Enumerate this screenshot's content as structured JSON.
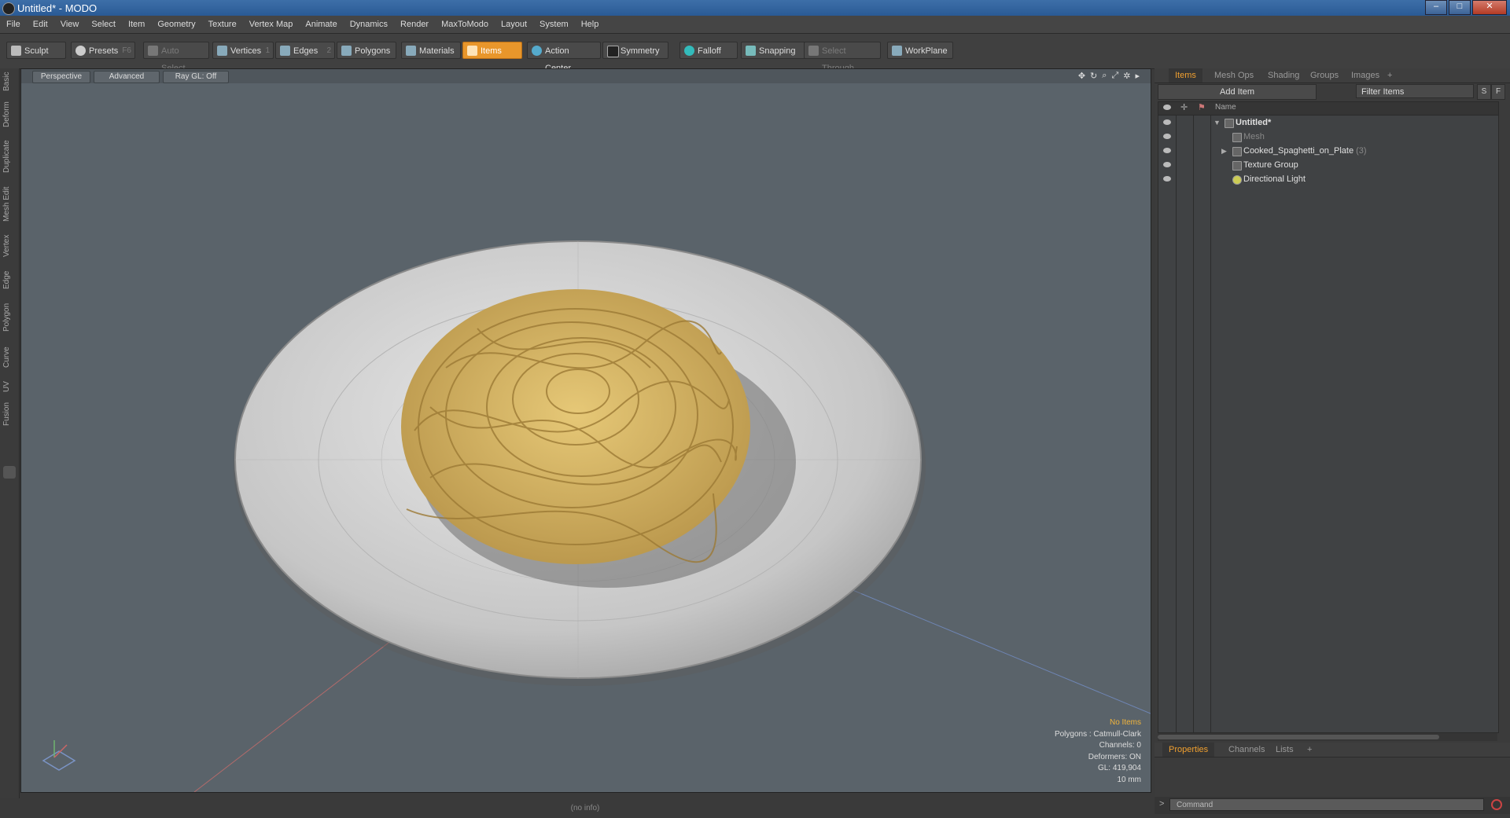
{
  "window": {
    "title": "Untitled* - MODO",
    "minimize": "–",
    "maximize": "□",
    "close": "✕"
  },
  "menu": [
    "File",
    "Edit",
    "View",
    "Select",
    "Item",
    "Geometry",
    "Texture",
    "Vertex Map",
    "Animate",
    "Dynamics",
    "Render",
    "MaxToModo",
    "Layout",
    "System",
    "Help"
  ],
  "toolbar": {
    "sculpt": "Sculpt",
    "presets": "Presets",
    "presets_key": "F6",
    "auto_select": "Auto Select",
    "vertices": "Vertices",
    "vertices_key": "1",
    "edges": "Edges",
    "edges_key": "2",
    "polygons": "Polygons",
    "materials": "Materials",
    "items": "Items",
    "action_center": "Action Center",
    "symmetry": "Symmetry",
    "falloff": "Falloff",
    "snapping": "Snapping",
    "select_through": "Select Through",
    "workplane": "WorkPlane"
  },
  "left_tabs": [
    "Basic",
    "Deform",
    "Duplicate",
    "Mesh Edit",
    "Vertex",
    "Edge",
    "Polygon",
    "Curve",
    "UV",
    "Fusion"
  ],
  "viewport": {
    "view_mode": "Perspective",
    "shading": "Advanced",
    "ray_gl": "Ray GL: Off",
    "info": {
      "selection": "No Items",
      "polygons": "Polygons : Catmull-Clark",
      "channels": "Channels: 0",
      "deformers": "Deformers: ON",
      "gl": "GL: 419,904",
      "grid": "10 mm"
    }
  },
  "items_panel": {
    "tabs": [
      "Items",
      "Mesh Ops",
      "Shading",
      "Groups",
      "Images",
      "+"
    ],
    "add_item": "Add Item",
    "filter_placeholder": "Filter Items",
    "btn_s": "S",
    "btn_f": "F",
    "column_name": "Name",
    "tree": [
      {
        "label": "Untitled*",
        "count": ""
      },
      {
        "label": "Mesh",
        "count": ""
      },
      {
        "label": "Cooked_Spaghetti_on_Plate",
        "count": "(3)"
      },
      {
        "label": "Texture Group",
        "count": ""
      },
      {
        "label": "Directional Light",
        "count": ""
      }
    ]
  },
  "properties_panel": {
    "tabs": [
      "Properties",
      "Channels",
      "Lists",
      "+"
    ]
  },
  "command": {
    "prompt": ">",
    "placeholder": "Command"
  },
  "status": {
    "info": "(no info)"
  },
  "colors": {
    "accent": "#e8962b",
    "viewport_bg": "#5a636a",
    "plate": "#c8c8c8",
    "pasta": "#d9b860"
  }
}
